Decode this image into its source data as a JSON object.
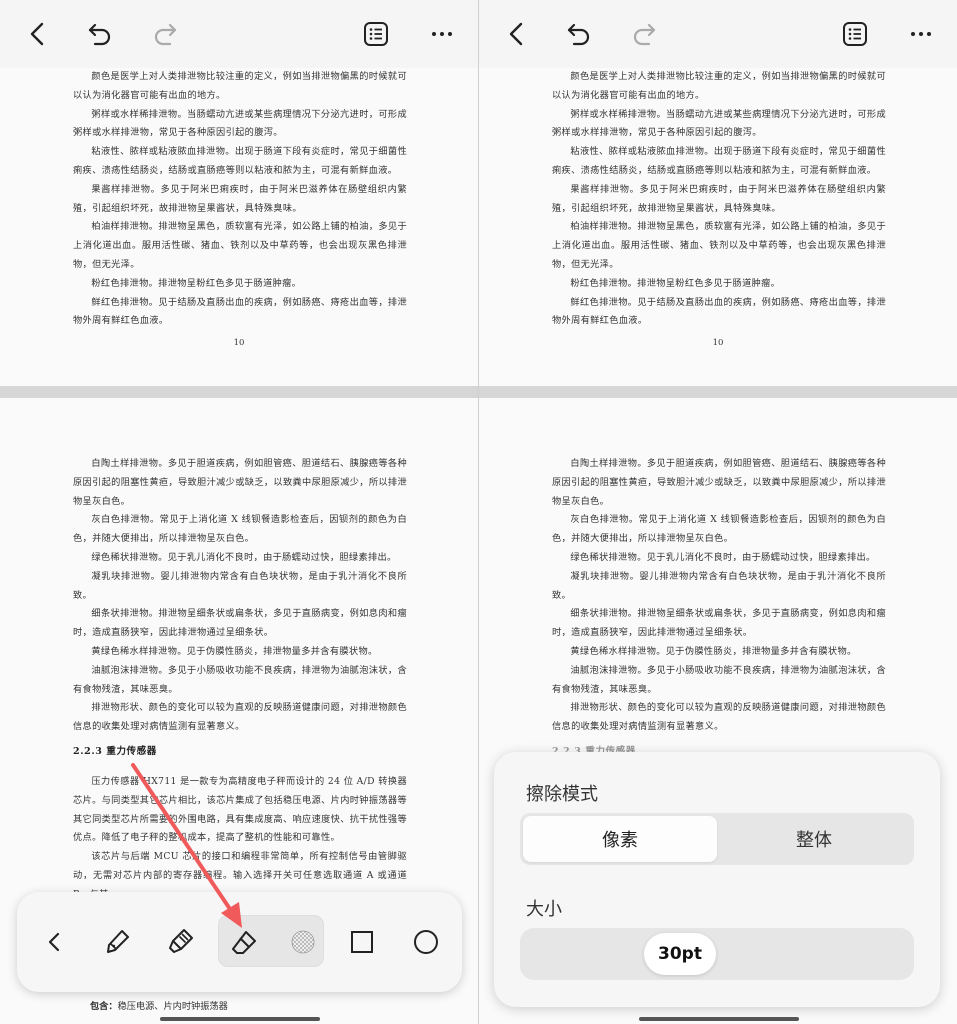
{
  "top_page": {
    "paragraphs": [
      "颜色是医学上对人类排泄物比较注重的定义，例如当排泄物偏黑的时候就可以认为消化器官可能有出血的地方。",
      "粥样或水样稀排泄物。当肠蠕动亢进或某些病理情况下分泌亢进时，可形成粥样或水样排泄物，常见于各种原因引起的腹泻。",
      "粘液性、脓样或粘液脓血排泄物。出现于肠道下段有炎症时，常见于细菌性痢疾、溃疡性结肠炎，结肠或直肠癌等则以粘液和脓为主，可混有新鲜血液。",
      "果酱样排泄物。多见于阿米巴痢疾时，由于阿米巴滋养体在肠壁组织内繁殖，引起组织坏死，故排泄物呈果酱状，具特殊臭味。",
      "柏油样排泄物。排泄物呈黑色，质软富有光泽，如公路上铺的柏油，多见于上消化道出血。服用活性碳、猪血、铁剂以及中草药等，也会出现灰黑色排泄物，但无光泽。",
      "粉红色排泄物。排泄物呈粉红色多见于肠道肿瘤。",
      "鲜红色排泄物。见于结肠及直肠出血的疾病，例如肠癌、痔疮出血等，排泄物外周有鲜红色血液。"
    ],
    "page_number": "10"
  },
  "bottom_page": {
    "paragraphs": [
      "白陶土样排泄物。多见于胆道疾病，例如胆管癌、胆道结石、胰腺癌等各种原因引起的阻塞性黄疸，导致胆汁减少或缺乏，以致粪中尿胆原减少，所以排泄物呈灰白色。",
      "灰白色排泄物。常见于上消化道 X 线钡餐造影检查后，因钡剂的颜色为白色，并随大便排出，所以排泄物呈灰白色。",
      "绿色稀状排泄物。见于乳儿消化不良时，由于肠蠕动过快，胆绿素排出。",
      "凝乳块排泄物。婴儿排泄物内常含有白色块状物，是由于乳汁消化不良所致。",
      "细条状排泄物。排泄物呈细条状或扁条状，多见于直肠病变，例如息肉和瘤时，造成直肠狭窄，因此排泄物通过呈细条状。",
      "黄绿色稀水样排泄物。见于伪膜性肠炎，排泄物量多并含有膜状物。",
      "油腻泡沫排泄物。多见于小肠吸收功能不良疾病，排泄物为油腻泡沫状，含有食物残渣，其味恶臭。",
      "排泄物形状、颜色的变化可以较为直观的反映肠道健康问题，对排泄物颜色信息的收集处理对病情监测有显著意义。"
    ],
    "section_heading": "2.2.3 重力传感器",
    "section_paragraphs": [
      "压力传感器 HX711 是一款专为高精度电子秤而设计的 24 位 A/D 转换器芯片。与同类型其它芯片相比，该芯片集成了包括稳压电源、片内时钟振荡器等其它同类型芯片所需要的外围电路，具有集成度高、响应速度快、抗干扰性强等优点。降低了电子秤的整机成本，提高了整机的性能和可靠性。",
      "该芯片与后端 MCU 芯片的接口和编程非常简单，所有控制信号由管脚驱动，无需对芯片内部的寄存器编程。输入选择开关可任意选取通道 A 或通道 B，与其"
    ],
    "bottom_label": "包含：",
    "bottom_text": "稳压电源、片内时钟振荡器"
  },
  "topbar": {
    "icons": [
      "back-icon",
      "undo-icon",
      "redo-icon",
      "outline-list-icon",
      "more-icon"
    ]
  },
  "draw_toolbar": {
    "tools": [
      "collapse-back-icon",
      "pen-icon",
      "marker-icon",
      "eraser-icon",
      "lasso-texture-icon",
      "rectangle-icon",
      "circle-icon"
    ],
    "selected": "eraser-icon"
  },
  "eraser_panel": {
    "title": "擦除模式",
    "options": [
      "像素",
      "整体"
    ],
    "selected_option": "像素",
    "size_label": "大小",
    "size_value": "30pt",
    "size_fraction": 0.3
  },
  "colors": {
    "annotation_arrow": "#f05a5a",
    "panel_bg": "#f6f6f6",
    "text": "#333333"
  }
}
